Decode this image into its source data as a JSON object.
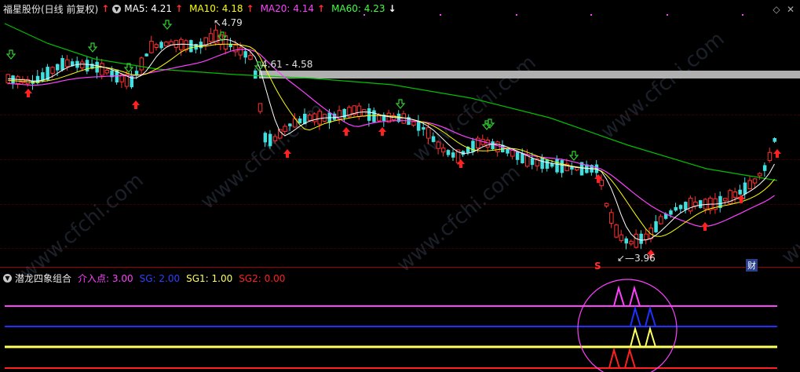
{
  "main": {
    "title": "福星股份(日线 前复权)",
    "ma5": "MA5: 4.21",
    "ma10": "MA10: 4.18",
    "ma20": "MA20: 4.14",
    "ma60": "MA60: 4.23",
    "ma5_dir": "↑",
    "ma10_dir": "↑",
    "ma20_dir": "↑",
    "ma60_dir": "↓",
    "title_dir": "↑",
    "high_label": "4.79",
    "range_label": "4.61 - 4.58",
    "low_label": "3.96",
    "badge_s": "S",
    "badge_cai": "财",
    "watermark": "www.cfchi.com",
    "colors": {
      "ma5": "#ffffff",
      "ma10": "#ffff00",
      "ma20": "#ff40ff",
      "ma60": "#00c000",
      "up": "#ff3030",
      "down": "#40e0e0"
    }
  },
  "sub": {
    "title": "潜龙四象组合",
    "p1": "介入点: 3.00",
    "p2": "SG: 2.00",
    "p3": "SG1: 1.00",
    "p4": "SG2: 0.00",
    "colors": {
      "p1": "#ff40ff",
      "p2": "#2030ff",
      "p3": "#ffff40",
      "p4": "#ff2020"
    }
  },
  "toolbar": {
    "diamond": "◇",
    "close": "✕"
  }
}
